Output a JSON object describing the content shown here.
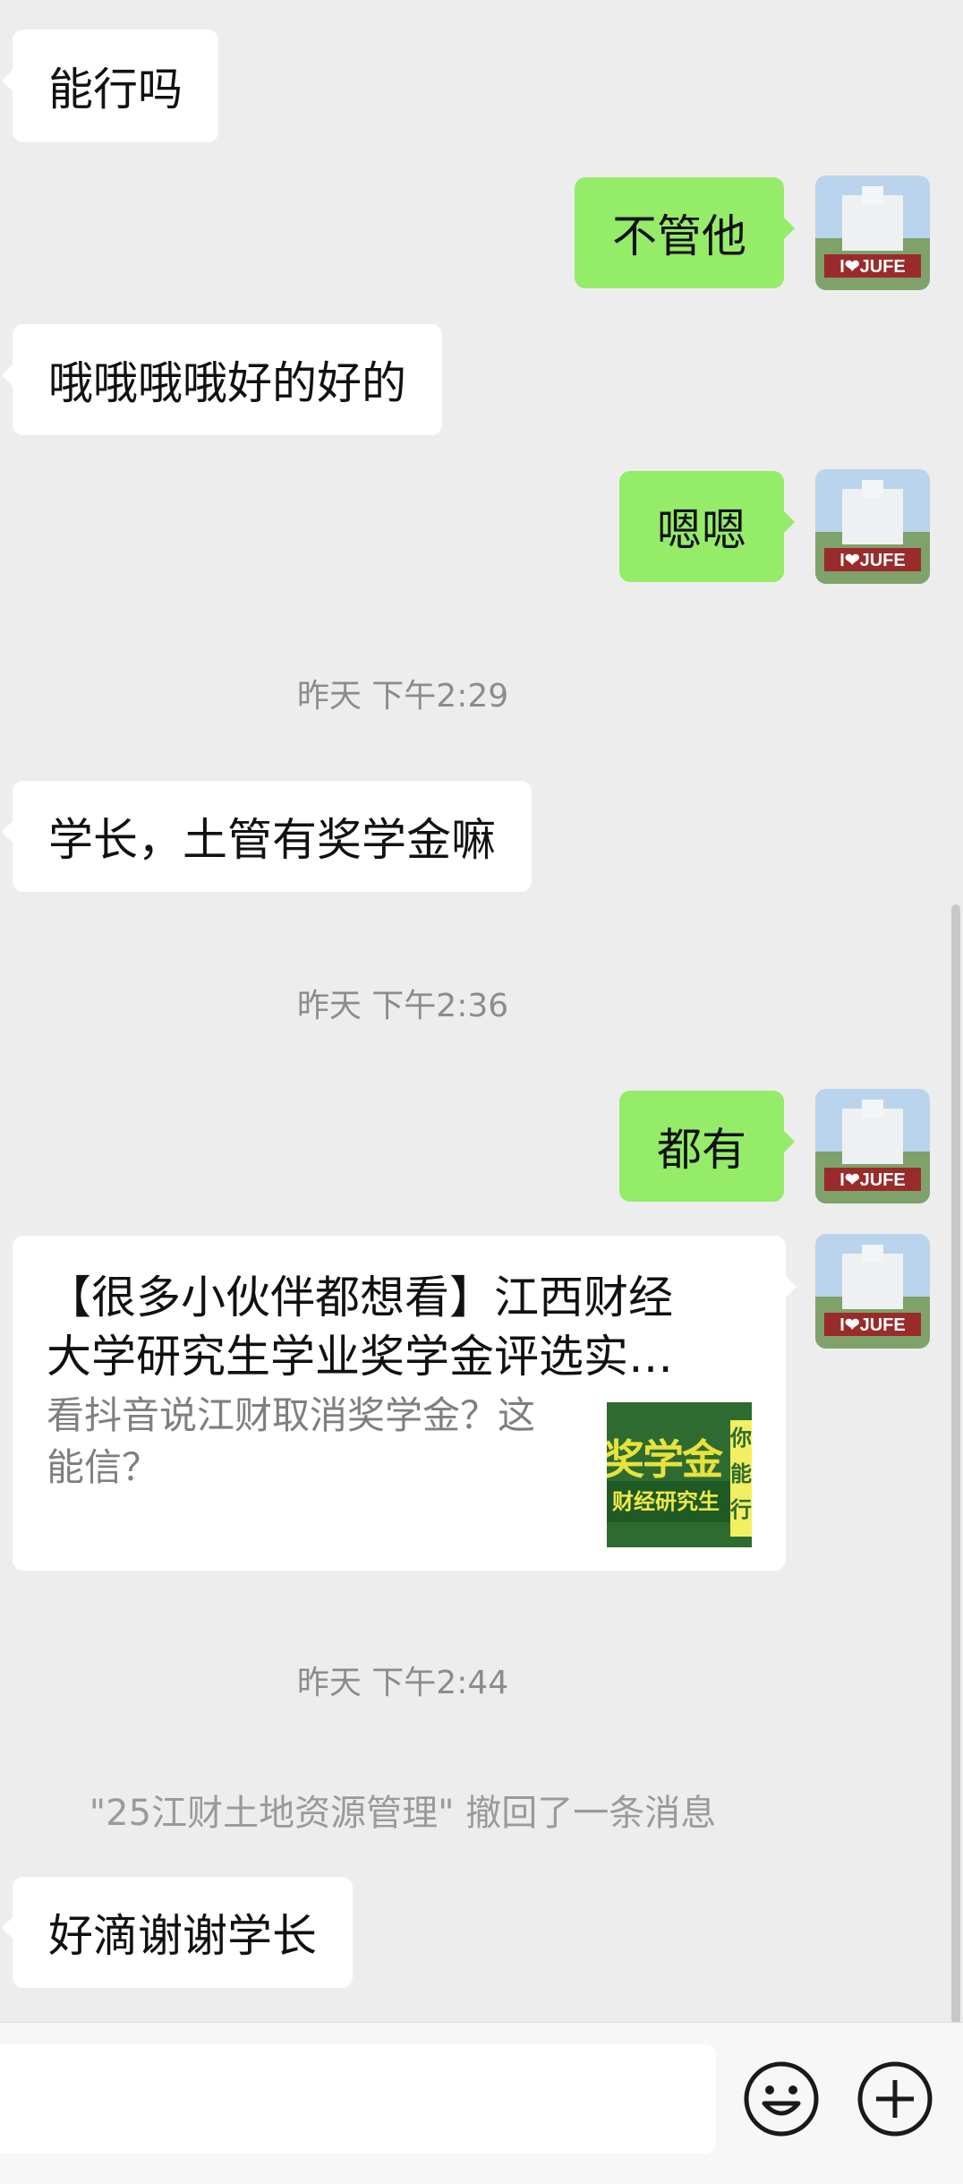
{
  "messages": [
    {
      "side": "in",
      "text": "能行吗"
    },
    {
      "side": "out",
      "text": "不管他"
    },
    {
      "side": "in",
      "text": "哦哦哦哦好的好的"
    },
    {
      "side": "out",
      "text": "嗯嗯"
    },
    {
      "side": "in",
      "text": "学长，土管有奖学金嘛"
    },
    {
      "side": "out",
      "text": "都有"
    },
    {
      "side": "in",
      "text": "好滴谢谢学长"
    }
  ],
  "timestamps": [
    "昨天 下午2:29",
    "昨天 下午2:36",
    "昨天 下午2:44"
  ],
  "shared_card": {
    "title_line1": "【很多小伙伴都想看】江西财经",
    "title_line2": "大学研究生学业奖学金评选实…",
    "desc_line1": "看抖音说江财取消奖学金？这",
    "desc_line2": "能信？",
    "thumb_text_main": "奖学金",
    "thumb_text_band": "财经研究生",
    "thumb_text_side": "你能行"
  },
  "recall_notice": "\"25江财土地资源管理\" 撤回了一条消息",
  "avatar_sign": "I❤JUFE",
  "input": {
    "placeholder": ""
  },
  "icons": {
    "emoji": "emoji-icon",
    "more": "plus-circle-icon"
  },
  "colors": {
    "background": "#ededed",
    "outgoing": "#95ec69",
    "incoming": "#ffffff"
  }
}
